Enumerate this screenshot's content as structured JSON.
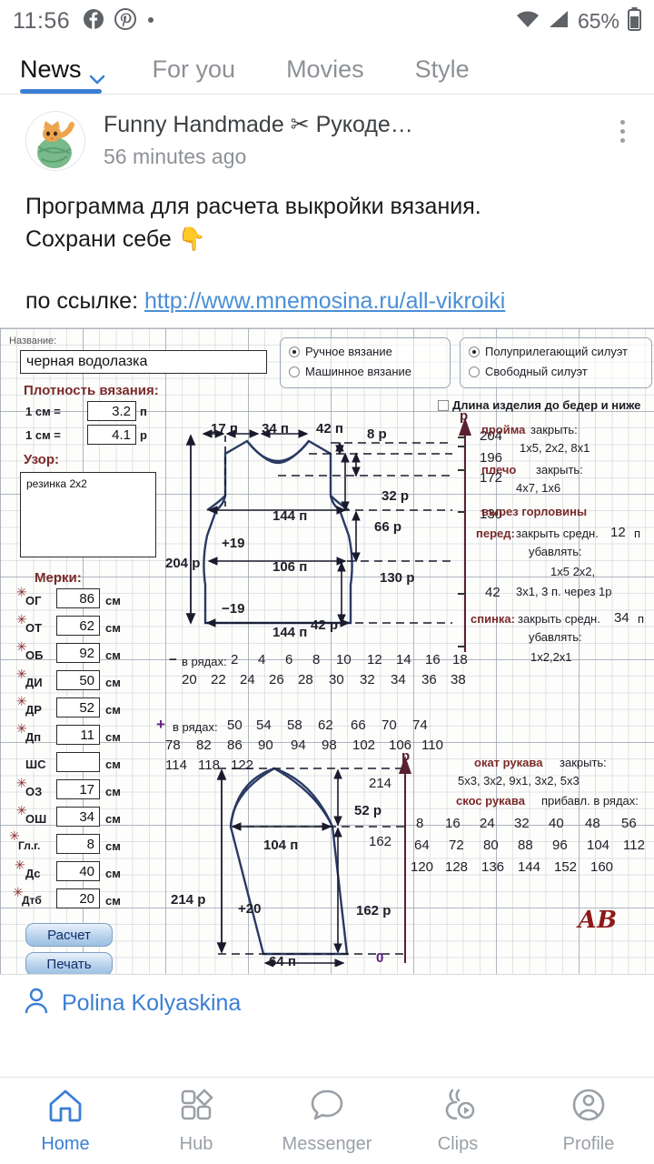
{
  "status_bar": {
    "time": "11:56",
    "battery_percent": "65%",
    "icons": [
      "facebook-icon",
      "pinterest-icon",
      "dot-icon",
      "wifi-icon",
      "signal-icon",
      "battery-icon"
    ]
  },
  "tabs": [
    {
      "label": "News",
      "active": true
    },
    {
      "label": "For you",
      "active": false
    },
    {
      "label": "Movies",
      "active": false
    },
    {
      "label": "Style",
      "active": false
    }
  ],
  "post": {
    "source": "Funny Handmade ✂ Рукоде…",
    "time": "56 minutes ago",
    "line1": "Программа для расчета выкройки вязания.",
    "line2": "Сохрани себе 👇",
    "link_prefix": "по ссылке: ",
    "link": "http://www.mnemosina.ru/all-vikroiki"
  },
  "attribution": {
    "name": "Polina Kolyaskina"
  },
  "bottom_nav": [
    {
      "label": "Home",
      "active": true
    },
    {
      "label": "Hub",
      "active": false
    },
    {
      "label": "Messenger",
      "active": false
    },
    {
      "label": "Clips",
      "active": false
    },
    {
      "label": "Profile",
      "active": false
    }
  ],
  "pattern": {
    "title_label": "Название:",
    "title_value": "черная водолазка",
    "density_label": "Плотность вязания:",
    "density_rows": [
      {
        "label": "1 см =",
        "value": "3.2",
        "unit": "п"
      },
      {
        "label": "1 см =",
        "value": "4.1",
        "unit": "р"
      }
    ],
    "pattern_label": "Узор:",
    "pattern_value": "резинка 2x2",
    "measurements_label": "Мерки:",
    "measurements": [
      {
        "name": "ОГ",
        "value": "86",
        "unit": "см",
        "req": true
      },
      {
        "name": "ОТ",
        "value": "62",
        "unit": "см",
        "req": true
      },
      {
        "name": "ОБ",
        "value": "92",
        "unit": "см",
        "req": true
      },
      {
        "name": "ДИ",
        "value": "50",
        "unit": "см",
        "req": true
      },
      {
        "name": "ДР",
        "value": "52",
        "unit": "см",
        "req": true
      },
      {
        "name": "Дп",
        "value": "11",
        "unit": "см",
        "req": true
      },
      {
        "name": "ШС",
        "value": "",
        "unit": "см",
        "req": false
      },
      {
        "name": "ОЗ",
        "value": "17",
        "unit": "см",
        "req": true
      },
      {
        "name": "ОШ",
        "value": "34",
        "unit": "см",
        "req": true
      },
      {
        "name": "Гл.г.",
        "value": "8",
        "unit": "см",
        "req": true
      },
      {
        "name": "Дс",
        "value": "40",
        "unit": "см",
        "req": true
      },
      {
        "name": "Дтб",
        "value": "20",
        "unit": "см",
        "req": true
      }
    ],
    "buttons": {
      "calc": "Расчет",
      "print": "Печать"
    },
    "knit_type": [
      {
        "label": "Ручное вязание",
        "selected": true
      },
      {
        "label": "Машинное вязание",
        "selected": false
      }
    ],
    "silhouette": [
      {
        "label": "Полуприлегающий силуэт",
        "selected": true
      },
      {
        "label": "Свободный силуэт",
        "selected": false
      }
    ],
    "length_checkbox": {
      "label": "Длина изделия до бедер и ниже",
      "checked": false
    },
    "body": {
      "top_widths": [
        "17  п",
        "34  п",
        "42  п"
      ],
      "left_height": "204  р",
      "rights": [
        "8  р",
        "32  р",
        "66  р",
        "130  р",
        "42  р"
      ],
      "inner_widths": [
        "144  п",
        "106  п",
        "144  п"
      ],
      "increase": "+19",
      "decrease": "−19"
    },
    "axis_body": {
      "unit": "р",
      "ticks": [
        "204",
        "196",
        "172",
        "130",
        "42"
      ]
    },
    "axis_sleeve": {
      "unit": "р",
      "ticks": [
        "214",
        "162",
        "0"
      ]
    },
    "rows_minus": {
      "label": "в рядах:",
      "sign": "−",
      "values": [
        "2",
        "4",
        "6",
        "8",
        "10",
        "12",
        "14",
        "16",
        "18",
        "20",
        "22",
        "24",
        "26",
        "28",
        "30",
        "32",
        "34",
        "36",
        "38"
      ]
    },
    "rows_plus": {
      "label": "в рядах:",
      "sign": "+",
      "values": [
        "50",
        "54",
        "58",
        "62",
        "66",
        "70",
        "74",
        "78",
        "82",
        "86",
        "90",
        "94",
        "98",
        "102",
        "106",
        "110",
        "114",
        "118",
        "122"
      ]
    },
    "sleeve": {
      "left_height": "214  р",
      "width_top": "104  п",
      "width_bottom": "64  п",
      "increase": "+20",
      "cap_height": "52  р",
      "body_height": "162  р"
    },
    "instructions": {
      "armhole": {
        "title": "пройма",
        "action": "закрыть:",
        "values": "1x5,  2x2,  8x1"
      },
      "shoulder": {
        "title": "плечо",
        "action": "закрыть:",
        "values": "4x7,  1x6"
      },
      "neckline_title": "вырез горловины",
      "front": {
        "label": "перед:",
        "action": "закрыть средн.",
        "count": "12",
        "unit": "п",
        "decrease_label": "убавлять:",
        "values_line1": "1x5  2x2,",
        "values_line2": "3x1, 3 п. через 1р"
      },
      "back": {
        "label": "спинка:",
        "action": "закрыть средн.",
        "count": "34",
        "unit": "п",
        "decrease_label": "убавлять:",
        "values": "1x2,2x1"
      },
      "sleeve_cap": {
        "title": "окат рукава",
        "action": "закрыть:",
        "values": "5x3,  3x2,  9x1,  3x2,  5x3"
      },
      "sleeve_slope": {
        "title": "скос рукава",
        "action": "прибавл. в рядах:",
        "values": [
          "8",
          "16",
          "24",
          "32",
          "40",
          "48",
          "56",
          "64",
          "72",
          "80",
          "88",
          "96",
          "104",
          "112",
          "120",
          "128",
          "136",
          "144",
          "152",
          "160"
        ]
      }
    },
    "signature": "АВ"
  },
  "colors": {
    "accent": "#3b7fd4",
    "muted": "#9aa0a6",
    "link": "#4a8fd6",
    "label_red": "#7a2a2a"
  }
}
